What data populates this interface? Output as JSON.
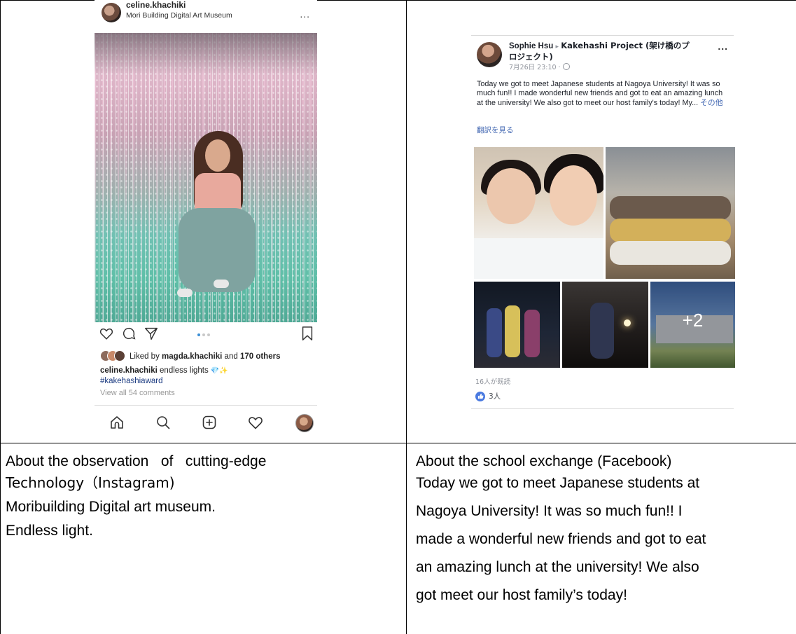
{
  "instagram": {
    "username": "celine.khachiki",
    "location": "Mori Building Digital Art Museum",
    "more": "...",
    "liked_by_prefix": "Liked by",
    "liked_by_user": "magda.khachiki",
    "liked_by_and": "and",
    "liked_by_count": "170 others",
    "caption_user": "celine.khachiki",
    "caption_text": "endless lights",
    "caption_emoji": "💎✨",
    "hashtag": "#kakehashiaward",
    "view_comments": "View all 54 comments",
    "carousel_dots": 3,
    "carousel_active": 1,
    "icons": [
      "heart-icon",
      "comment-icon",
      "share-icon",
      "bookmark-icon",
      "home-icon",
      "search-icon",
      "add-post-icon",
      "activity-heart-icon",
      "profile-avatar"
    ]
  },
  "facebook": {
    "author": "Sophie Hsu",
    "arrow": "▸",
    "group": "Kakehashi Project (架け橋のプロジェクト)",
    "time": "7月26日 23:10 · ",
    "more": "...",
    "post_text": "Today we got to meet Japanese students at Nagoya University! It was so much fun!! I made wonderful new friends and got to eat an amazing lunch at the university! We also got to meet our host family's today! My...",
    "see_more": "その他",
    "translate": "翻訳を見る",
    "extra_photos": "+2",
    "seen_by": "16人が既読",
    "likes": "3人",
    "accent_color": "#4267b2"
  },
  "captions": {
    "left": {
      "line1": "About the observation   of   cutting-edge",
      "line2": "Technology（Instagram)",
      "line3": "Moribuilding Digital art museum.",
      "line4": "Endless light."
    },
    "right": {
      "line1": "About the school exchange (Facebook)",
      "line2": "Today we got to meet Japanese students at",
      "line3": "Nagoya University! It was so much fun!! I",
      "line4": "made a wonderful new friends and got to eat",
      "line5": "an amazing lunch at the university! We also",
      "line6": "got meet our host family’s today!"
    }
  }
}
